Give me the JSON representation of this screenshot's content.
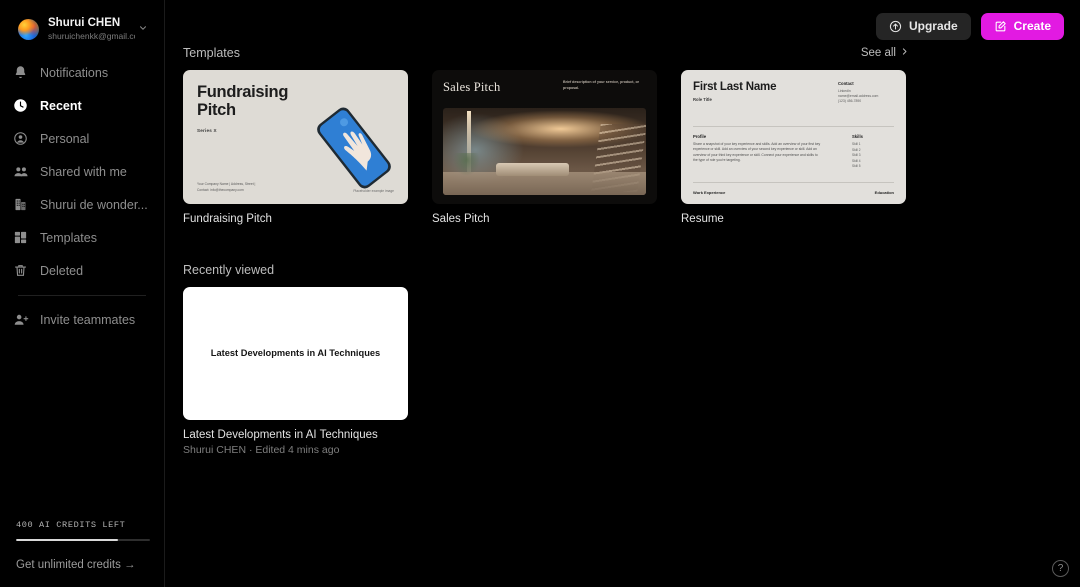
{
  "colors": {
    "background": "#000000",
    "sidebar_border": "#1b1b1b",
    "accent_create": "#e21ae2",
    "upgrade_bg": "#252525",
    "text_muted": "#8e8e8e"
  },
  "sidebar": {
    "profile": {
      "name": "Shurui CHEN",
      "email": "shuruichenkk@gmail.co...",
      "chevron": "⌄"
    },
    "items": [
      {
        "label": "Notifications",
        "icon": "bell-icon",
        "active": false
      },
      {
        "label": "Recent",
        "icon": "clock-icon",
        "active": true
      },
      {
        "label": "Personal",
        "icon": "person-circle-icon",
        "active": false
      },
      {
        "label": "Shared with me",
        "icon": "people-icon",
        "active": false
      },
      {
        "label": "Shurui de wonder...",
        "icon": "building-icon",
        "active": false
      },
      {
        "label": "Templates",
        "icon": "grid-icon",
        "active": false
      },
      {
        "label": "Deleted",
        "icon": "trash-icon",
        "active": false
      }
    ],
    "invite": {
      "label": "Invite teammates",
      "icon": "person-plus-icon"
    },
    "credits": {
      "label": "400 AI CREDITS LEFT",
      "progress_percent": 76,
      "link": "Get unlimited credits →"
    }
  },
  "topbar": {
    "upgrade_label": "Upgrade",
    "upgrade_icon": "arrow-up-circle-icon",
    "create_label": "Create",
    "create_icon": "edit-square-icon"
  },
  "templates_section": {
    "title": "Templates",
    "see_all": "See all",
    "see_all_chevron": "›",
    "cards": [
      {
        "title": "Fundraising Pitch",
        "thumb": {
          "heading_line1": "Fundraising",
          "heading_line2": "Pitch",
          "subtitle": "Series X",
          "footer": "Your Company Name | Address, Street |\nContact: info@thecompany.com",
          "caption": "Placeholder example image"
        }
      },
      {
        "title": "Sales Pitch",
        "thumb": {
          "heading": "Sales Pitch",
          "description": "Brief description of your service, product, or proposal."
        }
      },
      {
        "title": "Resume",
        "thumb": {
          "name": "First Last Name",
          "role": "Role Title",
          "contact_header": "Contact",
          "contact_lines": [
            "LinkedIn",
            "name@email.address.com",
            "(123) 456-7890"
          ],
          "profile_header": "Profile",
          "profile_text": "Share a snapshot of your key experience and skills. Add an overview of your first key experience or skill. Add an overview of your second key experience or skill. Add an overview of your third key experience or skill. Connect your experience and skills to the type of role you're targeting.",
          "skills_header": "Skills",
          "skills": [
            "Skill 1",
            "Skill 2",
            "Skill 3",
            "Skill 4",
            "Skill 5"
          ],
          "work_header": "Work Experience",
          "education_header": "Education"
        }
      }
    ]
  },
  "recent_section": {
    "title": "Recently viewed",
    "cards": [
      {
        "title": "Latest Developments in AI Techniques",
        "thumb_text": "Latest Developments in AI Techniques",
        "meta": "Shurui CHEN · Edited 4 mins ago"
      }
    ]
  },
  "help": {
    "icon": "question-mark-icon",
    "label": "?"
  }
}
